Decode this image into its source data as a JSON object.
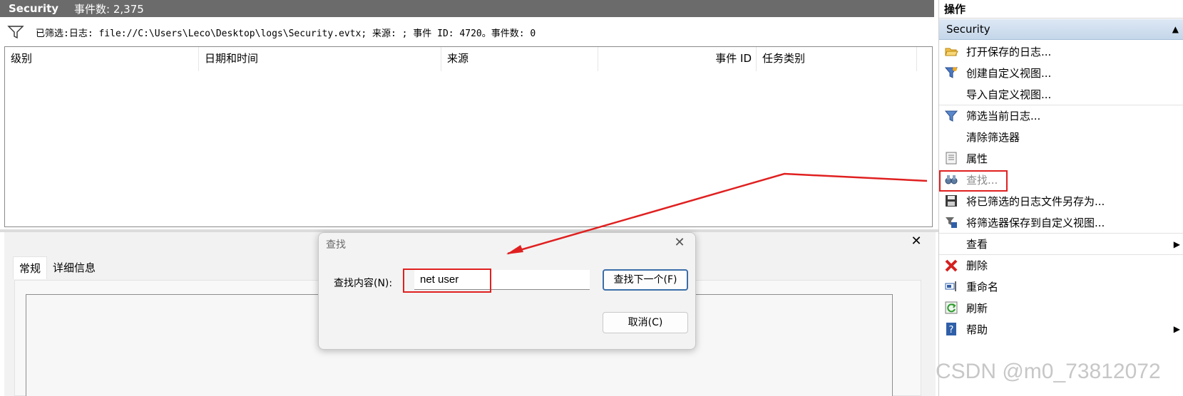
{
  "titlebar": {
    "log_name": "Security",
    "event_count": "事件数: 2,375"
  },
  "filter_text": "已筛选:日志: file://C:\\Users\\Leco\\Desktop\\logs\\Security.evtx; 来源: ; 事件 ID: 4720。事件数: 0",
  "columns": {
    "level": "级别",
    "datetime": "日期和时间",
    "source": "来源",
    "event_id": "事件 ID",
    "task": "任务类别"
  },
  "detail_tabs": {
    "general": "常规",
    "details": "详细信息"
  },
  "dialog": {
    "title": "查找",
    "label": "查找内容(N):",
    "input_value": "net user",
    "find_next": "查找下一个(F)",
    "cancel": "取消(C)"
  },
  "actions": {
    "header": "操作",
    "section": "Security",
    "items": [
      {
        "label": "打开保存的日志...",
        "icon": "folder-open-icon"
      },
      {
        "label": "创建自定义视图...",
        "icon": "filter-add-icon"
      },
      {
        "label": "导入自定义视图...",
        "icon": ""
      },
      {
        "label": "筛选当前日志...",
        "icon": "filter-icon"
      },
      {
        "label": "清除筛选器",
        "icon": ""
      },
      {
        "label": "属性",
        "icon": "properties-icon"
      },
      {
        "label": "查找...",
        "icon": "binoculars-icon"
      },
      {
        "label": "将已筛选的日志文件另存为...",
        "icon": "save-icon"
      },
      {
        "label": "将筛选器保存到自定义视图...",
        "icon": "save-filter-icon"
      },
      {
        "label": "查看",
        "icon": ""
      },
      {
        "label": "删除",
        "icon": "delete-icon"
      },
      {
        "label": "重命名",
        "icon": "rename-icon"
      },
      {
        "label": "刷新",
        "icon": "refresh-icon"
      },
      {
        "label": "帮助",
        "icon": "help-icon"
      }
    ]
  },
  "watermark": "CSDN @m0_73812072",
  "colors": {
    "annotation_red": "#e02020",
    "section_blue": "#c4d6ea"
  }
}
